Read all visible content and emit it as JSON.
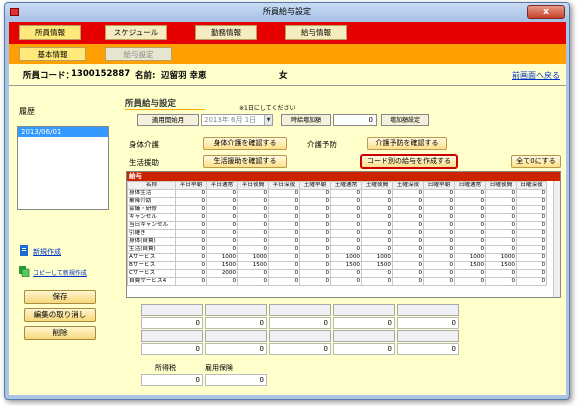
{
  "window": {
    "title": "所員給与設定",
    "close_label": "x"
  },
  "main_tabs": [
    {
      "label": "所員情報",
      "active": true
    },
    {
      "label": "スケジュール",
      "active": false
    },
    {
      "label": "勤務情報",
      "active": false
    },
    {
      "label": "給与情報",
      "active": false
    }
  ],
  "sub_tabs": [
    {
      "label": "基本情報",
      "active": true
    },
    {
      "label": "給与設定",
      "active": false
    }
  ],
  "employee": {
    "code_label": "所員コード：",
    "code": "1300152887",
    "name_label": "名前:",
    "name": "辺留羽 幸恵",
    "gender": "女",
    "back_link": "前画面へ戻る"
  },
  "history": {
    "label": "履歴",
    "items": [
      "2013/06/01"
    ],
    "new_link": "新規作成",
    "copy_link": "コピーして新規作成",
    "save_button": "保存",
    "cancel_button": "編集の取り消し",
    "delete_button": "削除"
  },
  "settings": {
    "section_title": "所員給与設定",
    "hint": "※1日にしてください",
    "start_month_label": "適用開始月",
    "start_month_value": "2013年 6月 1日",
    "hourly_add_label": "時給増加額",
    "hourly_add_value": "0",
    "hourly_set_button": "増加額設定",
    "rows": [
      {
        "label": "身体介護",
        "button": "身体介護を確認する"
      },
      {
        "label": "生活援助",
        "button": "生活援助を確認する"
      }
    ],
    "prevent_label": "介護予防",
    "prevent_button": "介護予防を確認する",
    "code_button": "コード別の給与を作成する",
    "zero_button": "全て0にする"
  },
  "table": {
    "title": "給与",
    "columns": [
      "名称",
      "平日早朝",
      "平日通常",
      "平日夜間",
      "平日深夜",
      "土曜早朝",
      "土曜通常",
      "土曜夜間",
      "土曜深夜",
      "日曜早朝",
      "日曜通常",
      "日曜夜間",
      "日曜深夜"
    ],
    "rows": [
      {
        "name": "身体生活",
        "values": [
          "0",
          "0",
          "0",
          "0",
          "0",
          "0",
          "0",
          "0",
          "0",
          "0",
          "0",
          "0"
        ]
      },
      {
        "name": "乗降介助",
        "values": [
          "0",
          "0",
          "0",
          "0",
          "0",
          "0",
          "0",
          "0",
          "0",
          "0",
          "0",
          "0"
        ]
      },
      {
        "name": "会議・研修",
        "values": [
          "0",
          "0",
          "0",
          "0",
          "0",
          "0",
          "0",
          "0",
          "0",
          "0",
          "0",
          "0"
        ]
      },
      {
        "name": "キャンセル",
        "values": [
          "0",
          "0",
          "0",
          "0",
          "0",
          "0",
          "0",
          "0",
          "0",
          "0",
          "0",
          "0"
        ]
      },
      {
        "name": "当日キャンセル",
        "values": [
          "0",
          "0",
          "0",
          "0",
          "0",
          "0",
          "0",
          "0",
          "0",
          "0",
          "0",
          "0"
        ]
      },
      {
        "name": "引継ぎ",
        "values": [
          "0",
          "0",
          "0",
          "0",
          "0",
          "0",
          "0",
          "0",
          "0",
          "0",
          "0",
          "0"
        ]
      },
      {
        "name": "身体(自費)",
        "values": [
          "0",
          "0",
          "0",
          "0",
          "0",
          "0",
          "0",
          "0",
          "0",
          "0",
          "0",
          "0"
        ]
      },
      {
        "name": "生活(自費)",
        "values": [
          "0",
          "0",
          "0",
          "0",
          "0",
          "0",
          "0",
          "0",
          "0",
          "0",
          "0",
          "0"
        ]
      },
      {
        "name": "Aサービス",
        "values": [
          "0",
          "1000",
          "1000",
          "0",
          "0",
          "1000",
          "1000",
          "0",
          "0",
          "1000",
          "1000",
          "0"
        ]
      },
      {
        "name": "Bサービス",
        "values": [
          "0",
          "1500",
          "1500",
          "0",
          "0",
          "1500",
          "1500",
          "0",
          "0",
          "1500",
          "1500",
          "0"
        ]
      },
      {
        "name": "Cサービス",
        "values": [
          "0",
          "2000",
          "0",
          "0",
          "0",
          "0",
          "0",
          "0",
          "0",
          "0",
          "0",
          "0"
        ]
      },
      {
        "name": "自費サービス4",
        "values": [
          "0",
          "0",
          "0",
          "0",
          "0",
          "0",
          "0",
          "0",
          "0",
          "0",
          "0",
          "0"
        ]
      }
    ]
  },
  "summary": {
    "row1_values": [
      "0",
      "0",
      "0",
      "0",
      "0"
    ],
    "row2_values": [
      "0",
      "0",
      "0",
      "0",
      "0"
    ],
    "tax_label": "所得税",
    "employment_label": "雇用保険",
    "tax_value": "0",
    "employment_value": "0"
  }
}
